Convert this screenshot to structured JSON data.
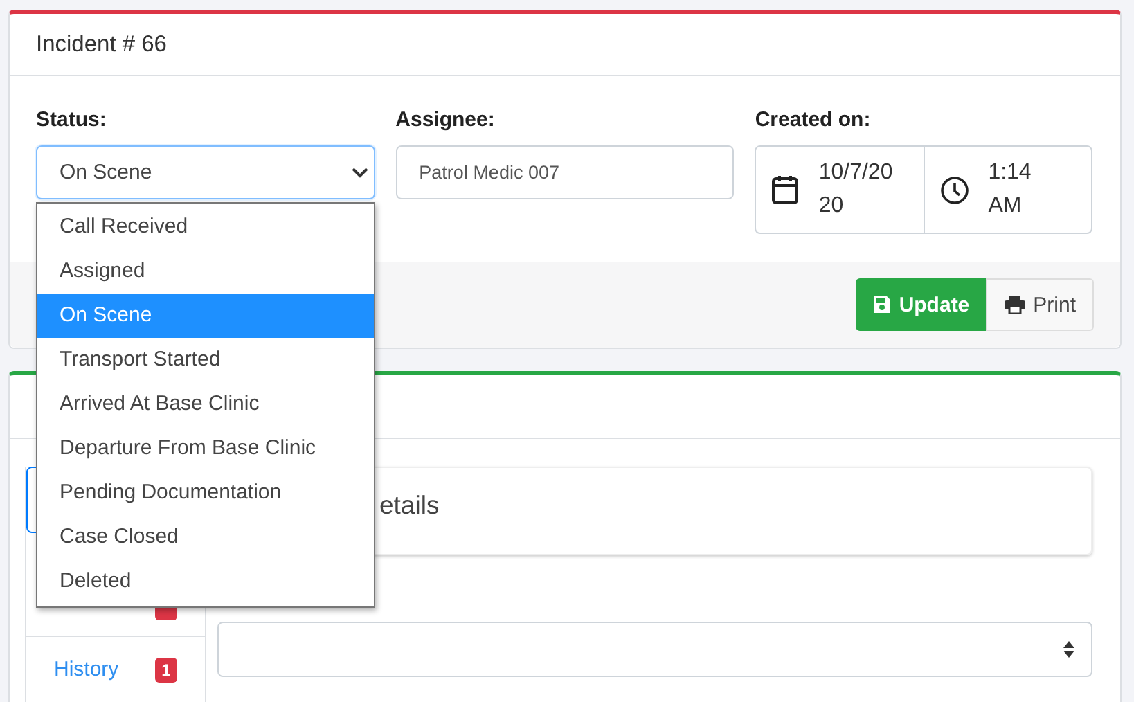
{
  "incident_card": {
    "title": "Incident # 66",
    "fields": [
      {
        "kind": "select",
        "label": "Status:",
        "value": "On Scene"
      },
      {
        "kind": "text",
        "label": "Assignee:",
        "value": "Patrol Medic 007"
      },
      {
        "kind": "datetime",
        "label": "Created on:",
        "date": "10/7/20\n20",
        "time": "1:14\nAM"
      }
    ],
    "buttons": [
      {
        "kind": "primary",
        "label": "Update"
      },
      {
        "kind": "secondary",
        "label": "Print"
      }
    ]
  },
  "status_dropdown": {
    "options": [
      {
        "label": "Call Received",
        "selected": false
      },
      {
        "label": "Assigned",
        "selected": false
      },
      {
        "label": "On Scene",
        "selected": true
      },
      {
        "label": "Transport Started",
        "selected": false
      },
      {
        "label": "Arrived At Base Clinic",
        "selected": false
      },
      {
        "label": "Departure From Base Clinic",
        "selected": false
      },
      {
        "label": "Pending Documentation",
        "selected": false
      },
      {
        "label": "Case Closed",
        "selected": false
      },
      {
        "label": "Deleted",
        "selected": false
      }
    ]
  },
  "details_card": {
    "side_tabs": [
      {
        "selected": true
      },
      {
        "selected": false,
        "badge": true
      },
      {
        "label": "History",
        "selected": false,
        "badge": true,
        "count": "1"
      }
    ],
    "panel_title": "etails"
  }
}
